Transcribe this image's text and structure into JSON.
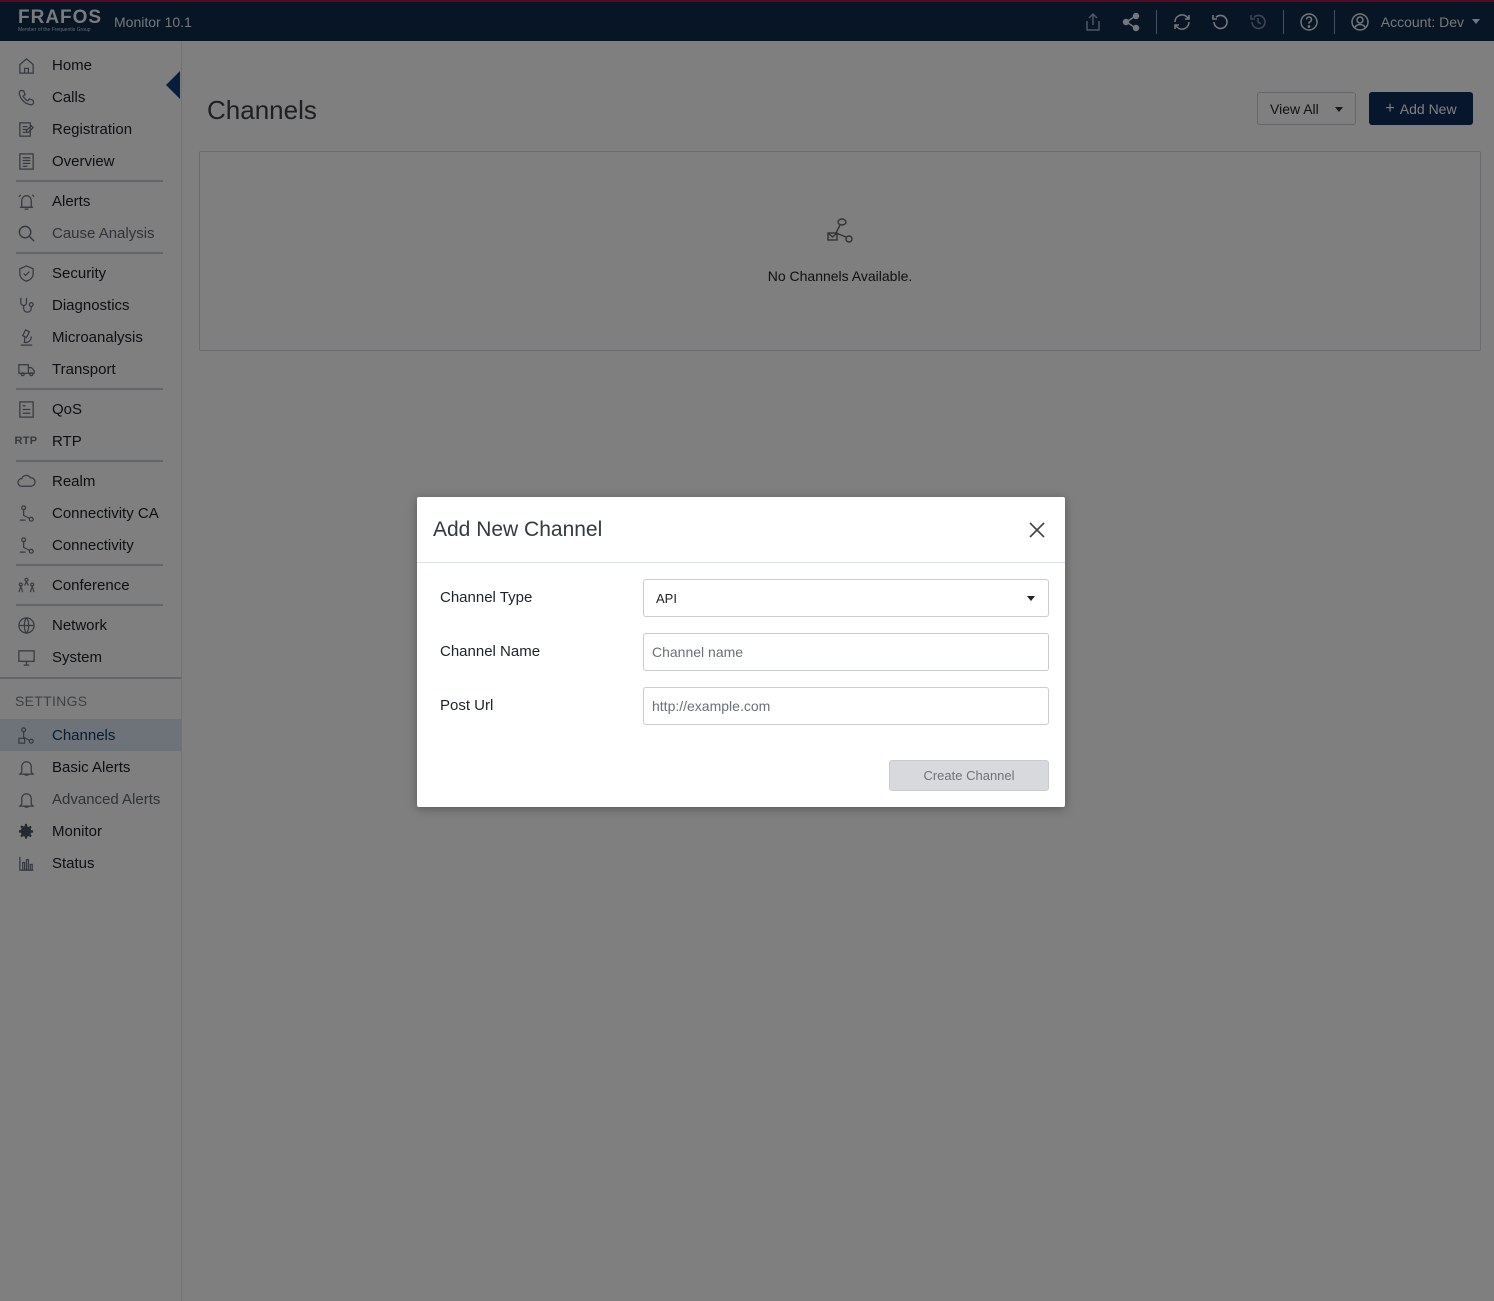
{
  "topbar": {
    "brand": "FRAFOS",
    "brand_tagline": "Member of the Frequentis Group",
    "app_name": "Monitor 10.1",
    "account_label": "Account: Dev",
    "icons": [
      "export-icon",
      "share-icon",
      "refresh-icon",
      "reset-icon",
      "history-icon",
      "help-icon",
      "user-icon"
    ]
  },
  "sidebar": {
    "groups": [
      [
        {
          "label": "Home",
          "icon": "home-icon"
        },
        {
          "label": "Calls",
          "icon": "phone-icon"
        },
        {
          "label": "Registration",
          "icon": "registration-icon"
        },
        {
          "label": "Overview",
          "icon": "overview-icon"
        }
      ],
      [
        {
          "label": "Alerts",
          "icon": "alarm-icon"
        },
        {
          "label": "Cause Analysis",
          "icon": "search-icon"
        }
      ],
      [
        {
          "label": "Security",
          "icon": "shield-icon"
        },
        {
          "label": "Diagnostics",
          "icon": "stethoscope-icon"
        },
        {
          "label": "Microanalysis",
          "icon": "microscope-icon"
        },
        {
          "label": "Transport",
          "icon": "truck-icon"
        }
      ],
      [
        {
          "label": "QoS",
          "icon": "qos-icon"
        },
        {
          "label": "RTP",
          "icon": "rtp-icon"
        }
      ],
      [
        {
          "label": "Realm",
          "icon": "cloud-icon"
        },
        {
          "label": "Connectivity CA",
          "icon": "connectivity-icon"
        },
        {
          "label": "Connectivity",
          "icon": "connectivity-icon"
        }
      ],
      [
        {
          "label": "Conference",
          "icon": "people-icon"
        }
      ],
      [
        {
          "label": "Network",
          "icon": "globe-icon"
        },
        {
          "label": "System",
          "icon": "monitor-icon"
        }
      ]
    ],
    "settings_label": "SETTINGS",
    "settings_items": [
      {
        "label": "Channels",
        "icon": "channels-icon"
      },
      {
        "label": "Basic Alerts",
        "icon": "bell-icon"
      },
      {
        "label": "Advanced Alerts",
        "icon": "bell-icon"
      },
      {
        "label": "Monitor",
        "icon": "gear-icon"
      },
      {
        "label": "Status",
        "icon": "bar-chart-icon"
      }
    ]
  },
  "main": {
    "title": "Channels",
    "view_all_label": "View All",
    "add_new_label": "Add New",
    "empty_text": "No Channels Available."
  },
  "modal": {
    "title": "Add New Channel",
    "channel_type_label": "Channel Type",
    "channel_type_value": "API",
    "channel_name_label": "Channel Name",
    "channel_name_placeholder": "Channel name",
    "post_url_label": "Post Url",
    "post_url_placeholder": "http://example.com",
    "create_label": "Create Channel"
  }
}
